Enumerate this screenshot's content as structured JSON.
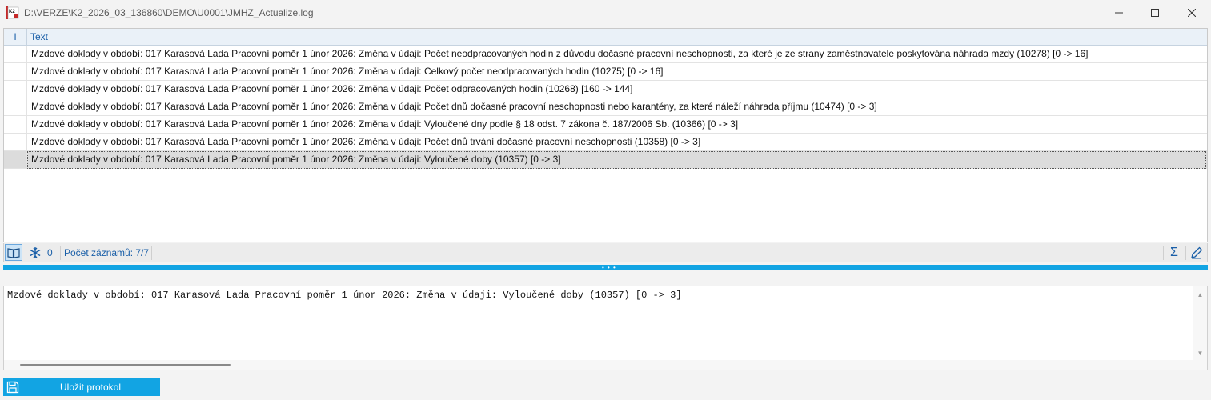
{
  "window": {
    "title": "D:\\VERZE\\K2_2026_03_136860\\DEMO\\U0001\\JMHZ_Actualize.log",
    "app_icon_text": "K2"
  },
  "grid": {
    "columns": {
      "indicator": "I",
      "text": "Text"
    },
    "rows": [
      "Mzdové doklady v období: 017 Karasová Lada Pracovní poměr 1 únor 2026: Změna v údaji: Počet neodpracovaných hodin z důvodu dočasné pracovní neschopnosti, za které je ze strany zaměstnavatele poskytována náhrada mzdy (10278) [0 -> 16]",
      "Mzdové doklady v období: 017 Karasová Lada Pracovní poměr 1 únor 2026: Změna v údaji: Celkový počet neodpracovaných hodin (10275) [0 -> 16]",
      "Mzdové doklady v období: 017 Karasová Lada Pracovní poměr 1 únor 2026: Změna v údaji: Počet odpracovaných hodin (10268) [160 -> 144]",
      "Mzdové doklady v období: 017 Karasová Lada Pracovní poměr 1 únor 2026: Změna v údaji: Počet dnů dočasné pracovní neschopnosti nebo karantény, za které náleží náhrada příjmu (10474) [0 -> 3]",
      "Mzdové doklady v období: 017 Karasová Lada Pracovní poměr 1 únor 2026: Změna v údaji: Vyloučené dny podle § 18 odst. 7 zákona č. 187/2006 Sb. (10366) [0 -> 3]",
      "Mzdové doklady v období: 017 Karasová Lada Pracovní poměr 1 únor 2026: Změna v údaji: Počet dnů trvání dočasné pracovní neschopnosti (10358) [0 -> 3]",
      "Mzdové doklady v období: 017 Karasová Lada Pracovní poměr 1 únor 2026: Změna v údaji: Vyloučené doby (10357) [0 -> 3]"
    ],
    "selected_row": 7
  },
  "statusbar": {
    "filter_count": "0",
    "records_label": "Počet záznamů: 7/7"
  },
  "detail": {
    "text": "Mzdové doklady v období: 017 Karasová Lada Pracovní poměr 1 únor 2026: Změna v údaji: Vyloučené doby (10357) [0 -> 3]"
  },
  "actions": {
    "save_label": "Uložit protokol"
  },
  "colors": {
    "accent": "#12a4e3",
    "header_text": "#1a5fa8",
    "selected_row": "#dcdcdc"
  },
  "icons": {
    "book": "book-icon",
    "snowflake": "snowflake-icon",
    "sum": "sigma-icon",
    "edit": "pencil-icon",
    "save": "floppy-disk-icon"
  }
}
